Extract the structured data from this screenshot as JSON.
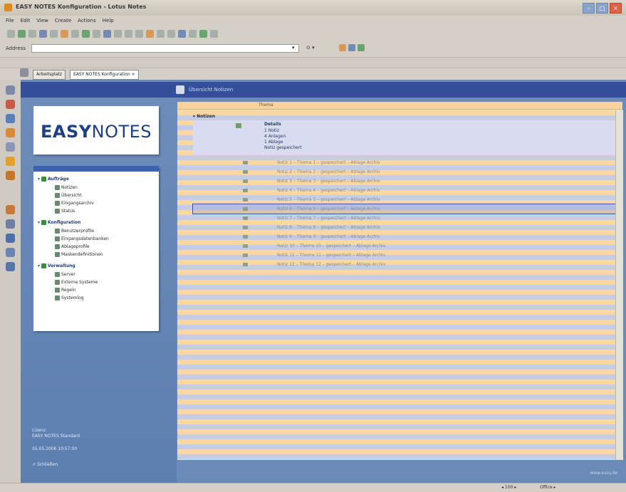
{
  "window": {
    "title": "EASY NOTES Konfiguration - Lotus Notes",
    "controls": [
      "–",
      "□",
      "×"
    ]
  },
  "menu": [
    "File",
    "Edit",
    "View",
    "Create",
    "Actions",
    "Help"
  ],
  "address": {
    "label": "Address",
    "dropdown": "▾",
    "go": "⊙ ▾"
  },
  "tabs": [
    "Arbeitsplatz",
    "EASY NOTES Konfiguration ×"
  ],
  "header": {
    "title": "Übersicht Notizen"
  },
  "logo": {
    "part1": "EASY",
    "part2": "NOTES"
  },
  "nav": {
    "groups": [
      {
        "label": "Aufträge",
        "items": [
          "Notizen",
          "Übersicht",
          "Eingangsarchiv",
          "Status"
        ]
      },
      {
        "label": "Konfiguration",
        "items": [
          "Benutzerprofile",
          "Eingangsdatenbanken",
          "Ablageprofile",
          "Maskendefinitionen"
        ]
      },
      {
        "label": "Verwaltung",
        "items": [
          "Server",
          "Externe Systeme",
          "Regeln",
          "Systemlog"
        ]
      }
    ]
  },
  "footer": {
    "line1": "Lizenz:",
    "line2": "EASY NOTES Standard",
    "date": "05.05.2006 10:57:00",
    "action": "Schließen"
  },
  "content": {
    "column": "Thema",
    "group": "Notizen",
    "detail": [
      "Details",
      "1 Notiz",
      "4 Anlagen",
      "1 Ablage",
      "Notiz gespeichert"
    ],
    "rows": [
      "Notiz 1 – Thema 1 – gespeichert – Ablage Archiv",
      "Notiz 2 – Thema 2 – gespeichert – Ablage Archiv",
      "Notiz 3 – Thema 3 – gespeichert – Ablage Archiv",
      "Notiz 4 – Thema 4 – gespeichert – Ablage Archiv",
      "Notiz 5 – Thema 5 – gespeichert – Ablage Archiv",
      "Notiz 6 – Thema 6 – gespeichert – Ablage Archiv",
      "Notiz 7 – Thema 7 – gespeichert – Ablage Archiv",
      "Notiz 8 – Thema 8 – gespeichert – Ablage Archiv",
      "Notiz 9 – Thema 9 – gespeichert – Ablage Archiv",
      "Notiz 10 – Thema 10 – gespeichert – Ablage Archiv",
      "Notiz 11 – Thema 11 – gespeichert – Ablage Archiv",
      "Notiz 12 – Thema 12 – gespeichert – Ablage Archiv"
    ],
    "bottomlink": "www.easy.de"
  },
  "status": {
    "zoom": "◂ 100 ▸",
    "mode": "Office ▸"
  }
}
